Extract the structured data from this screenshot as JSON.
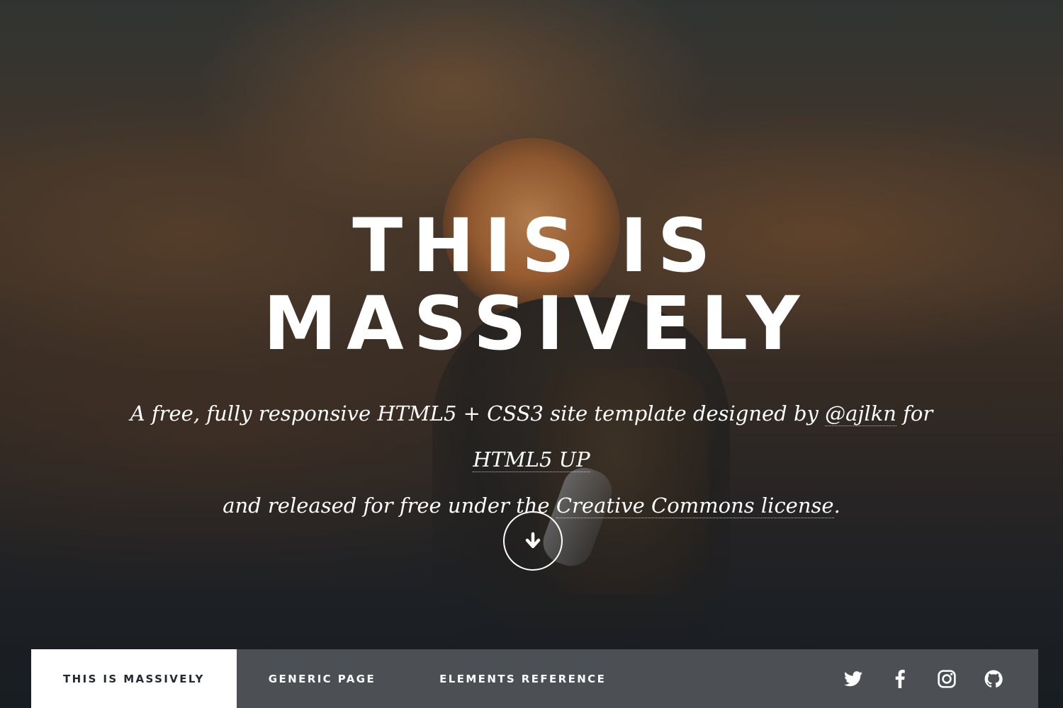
{
  "hero": {
    "title_line1": "THIS IS",
    "title_line2": "MASSIVELY",
    "desc_part1": "A free, fully responsive HTML5 + CSS3 site template designed by ",
    "author_link": "@ajlkn",
    "desc_part2": " for ",
    "html5up_link": "HTML5 UP",
    "desc_part3": " and released for free under the ",
    "license_link": "Creative Commons license",
    "desc_part4": ".",
    "scroll_icon": "arrow-down-icon"
  },
  "nav": {
    "links": [
      {
        "label": "THIS IS MASSIVELY",
        "active": true
      },
      {
        "label": "GENERIC PAGE",
        "active": false
      },
      {
        "label": "ELEMENTS REFERENCE",
        "active": false
      }
    ],
    "icons": [
      "twitter-icon",
      "facebook-icon",
      "instagram-icon",
      "github-icon"
    ]
  },
  "colors": {
    "text": "#ffffff",
    "nav_bg": "#505458",
    "active_text": "#212931"
  }
}
